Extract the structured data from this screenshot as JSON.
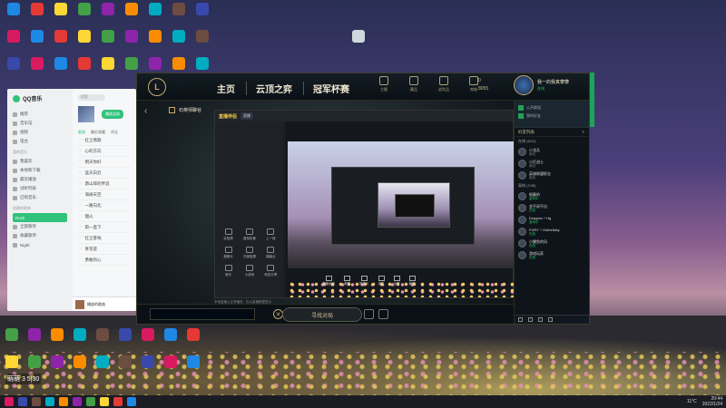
{
  "qq": {
    "app_name": "QQ音乐",
    "nav": [
      "推荐",
      "音乐馆",
      "视频",
      "电台"
    ],
    "section_mine": "我的音乐",
    "mine_items": [
      "我喜欢",
      "本地和下载",
      "最近播放",
      "试听列表",
      "已购音乐"
    ],
    "section_playlist": "创建的歌单",
    "playlist_active": "Rock",
    "playlist_items": [
      "全部歌单",
      "收藏歌单",
      "Night"
    ],
    "search_placeholder": "搜索",
    "play_all": "播放全部",
    "tabs": [
      "歌曲",
      "最近收藏",
      "评论"
    ],
    "songs": [
      "红尘情歌",
      "心的方向",
      "明天你好",
      "蓝天白云",
      "萧山郎的传说",
      "海阔天空",
      "一路向北",
      "烟火",
      "雨一直下",
      "红尘客栈",
      "青花瓷",
      "勇敢的心"
    ],
    "player_song": "播放的歌曲"
  },
  "lol": {
    "logo": "L",
    "nav": [
      "主页",
      "云顶之弈",
      "冠军杯赛"
    ],
    "top_icons": [
      "主题",
      "藏品",
      "战利品",
      "商城"
    ],
    "currency_be": "0",
    "currency_rp": "8055",
    "profile_name": "我一的我真攀攀",
    "profile_status": "在线",
    "panel_title": "石英师聊谷",
    "find_match": "寻找对局",
    "close": "✕"
  },
  "stream": {
    "brand": "直播伴侣",
    "tab_label": "直播",
    "tools": [
      "实验秀",
      "虚拟形象",
      "上一段",
      "摄像头",
      "外部投屏",
      "弹幕点",
      "音乐",
      "小游戏",
      "转发分享"
    ],
    "controls": [
      "直播画面",
      "美颜",
      "摄像头",
      "连麦",
      "全屏",
      "截图"
    ],
    "bottom_tip": "本地直播以正常播放，仅从直播数据显示"
  },
  "social": {
    "header_title": "社交",
    "header_items": [
      "公开群组",
      "我的好友"
    ],
    "list_title": "好友列表",
    "group_online": "在线 (6/12)",
    "group_offline": "离线 (7/48)",
    "friends": [
      {
        "name": "小龙兵",
        "status": "离线"
      },
      {
        "name": "小灯战士",
        "status": "离线"
      },
      {
        "name": "英雄联盟职业",
        "status": "离线"
      },
      {
        "name": "佩戴的",
        "status": "游戏中"
      },
      {
        "name": "会不说不出",
        "status": "在线"
      },
      {
        "name": "Dragons丶Hg",
        "status": "游戏中"
      },
      {
        "name": "FURY丶OntheWay",
        "status": "在线"
      },
      {
        "name": "小鲤鱼的风",
        "status": "在线"
      },
      {
        "name": "游戏玩家",
        "status": "在线"
      }
    ]
  },
  "taskbar": {
    "weather": "11°C",
    "time": "20:44",
    "date": "2022/1/24"
  },
  "desktop": {
    "overlay_text": "萌萌 3 5|30"
  },
  "colors": {
    "qq_green": "#31c27c",
    "lol_gold": "#c8aa6e",
    "online_green": "#1fc95b"
  }
}
